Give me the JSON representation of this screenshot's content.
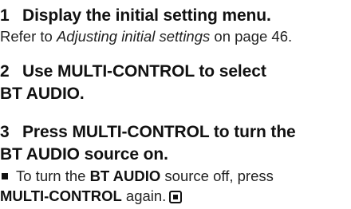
{
  "steps": [
    {
      "number": "1",
      "heading": "Display the initial setting menu.",
      "body": {
        "prefix": "Refer to ",
        "ref": "Adjusting initial settings",
        "suffix": " on page 46."
      }
    },
    {
      "number": "2",
      "heading_line1": "Use MULTI-CONTROL to select",
      "heading_line2": "BT AUDIO."
    },
    {
      "number": "3",
      "heading_line1": "Press MULTI-CONTROL to turn the",
      "heading_line2": "BT AUDIO source on.",
      "note": {
        "part1": "To turn the ",
        "bold1": "BT AUDIO",
        "part2": " source off, press",
        "bold2": "MULTI-CONTROL",
        "part3": " again."
      }
    }
  ],
  "icons": {
    "bullet": "square-bullet-icon",
    "end_mark": "end-of-section-icon"
  },
  "colors": {
    "text": "#111111",
    "background": "#ffffff"
  }
}
